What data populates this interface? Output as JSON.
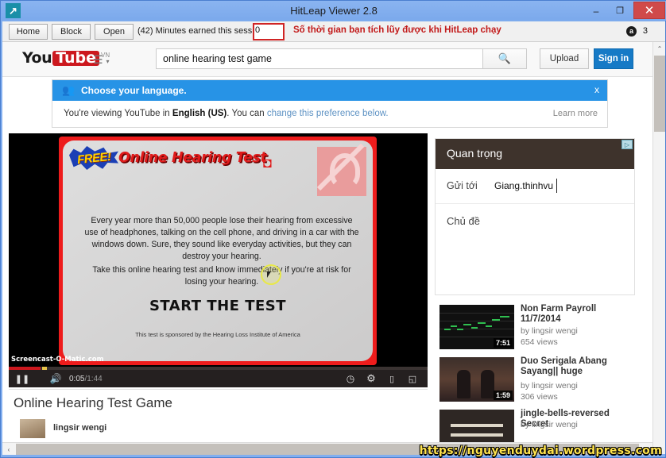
{
  "window": {
    "title": "HitLeap Viewer 2.8",
    "app_icon": "arrow-up-right-icon",
    "minimize": "–",
    "maximize": "❐",
    "close": "✕"
  },
  "hitleap_toolbar": {
    "home_label": "Home",
    "block_label": "Block",
    "open_label": "Open",
    "earned_label": "(42) Minutes earned this session:",
    "earned_value": "0",
    "note": "Số thời gian bạn tích lũy được khi HitLeap chạy",
    "coin_icon": "a",
    "coin_count": "3"
  },
  "youtube": {
    "logo_you": "You",
    "logo_tube": "Tube",
    "logo_country": "VN",
    "guide_icon": "hamburger-menu-icon",
    "search_value": "online hearing test game",
    "search_placeholder": "Search",
    "search_icon": "search-icon",
    "upload_label": "Upload",
    "signin_label": "Sign in"
  },
  "language_notice": {
    "icon": "people-icon",
    "title": "Choose your language.",
    "close": "x",
    "body_pre": "You're viewing YouTube in ",
    "body_lang": "English (US)",
    "body_mid": ". You can ",
    "body_link": "change this preference below.",
    "learn_more": "Learn more"
  },
  "player": {
    "poster": {
      "free_badge": "FREE!",
      "title": "Online Hearing Test",
      "waves_icon": "sound-waves-icon",
      "ear_icon": "hearing-impaired-icon",
      "paragraph1": "Every year more than 50,000 people lose their hearing from excessive use of headphones, talking on the cell phone, and driving in a car with the windows down. Sure, they sound like everyday activities, but they can destroy your hearing.",
      "paragraph2": "Take this online hearing test and know immediately if you're at risk for losing your hearing.",
      "cta": "START THE TEST",
      "sponsor": "This test is sponsored by the Hearing Loss Institute of America",
      "screencast_watermark": "Screencast-O-Matic.com"
    },
    "controls": {
      "play_icon": "pause-icon",
      "volume_icon": "volume-icon",
      "current_time": "0:05",
      "time_separator": " / ",
      "total_time": "1:44",
      "clock_icon": "watch-later-icon",
      "settings_icon": "gear-icon",
      "theater_icon": "theater-mode-icon",
      "fullscreen_icon": "fullscreen-icon"
    }
  },
  "video": {
    "title": "Online Hearing Test Game",
    "uploader": "lingsir wengi",
    "avatar_icon": "avatar"
  },
  "ad_panel": {
    "header_title": "Quan trọng",
    "ad_badge": "▷",
    "field1_label": "Gửi tới",
    "field1_value": "Giang.thinhvu",
    "field2_label": "Chủ đề"
  },
  "related_videos": [
    {
      "title": "Non Farm Payroll 11/7/2014",
      "by": "by lingsir wengi",
      "views": "654 views",
      "duration": "7:51",
      "thumb": "forex-chart-thumb"
    },
    {
      "title": "Duo Serigala Abang Sayang|| huge",
      "by": "by lingsir wengi",
      "views": "306 views",
      "duration": "1:59",
      "thumb": "duo-singers-thumb"
    },
    {
      "title": "jingle-bells-reversed Secret",
      "by": "by lingsir wengi",
      "views": "",
      "duration": "",
      "thumb": "jingle-bells-thumb"
    }
  ],
  "scrollbars": {
    "v_up": "⌃",
    "v_down": "⌄",
    "h_left": "‹"
  },
  "watermark": {
    "url": "https://nguyenduydai.wordpress.com"
  },
  "colors": {
    "titlebar": "#82aeee",
    "close_red": "#d04a4a",
    "youtube_red": "#cc181e",
    "signin_blue": "#167ac6",
    "notice_blue": "#2793e6",
    "note_red": "#c21a1a",
    "ad_header_brown": "#3e332c",
    "watermark_yellow": "#ffe34d"
  }
}
